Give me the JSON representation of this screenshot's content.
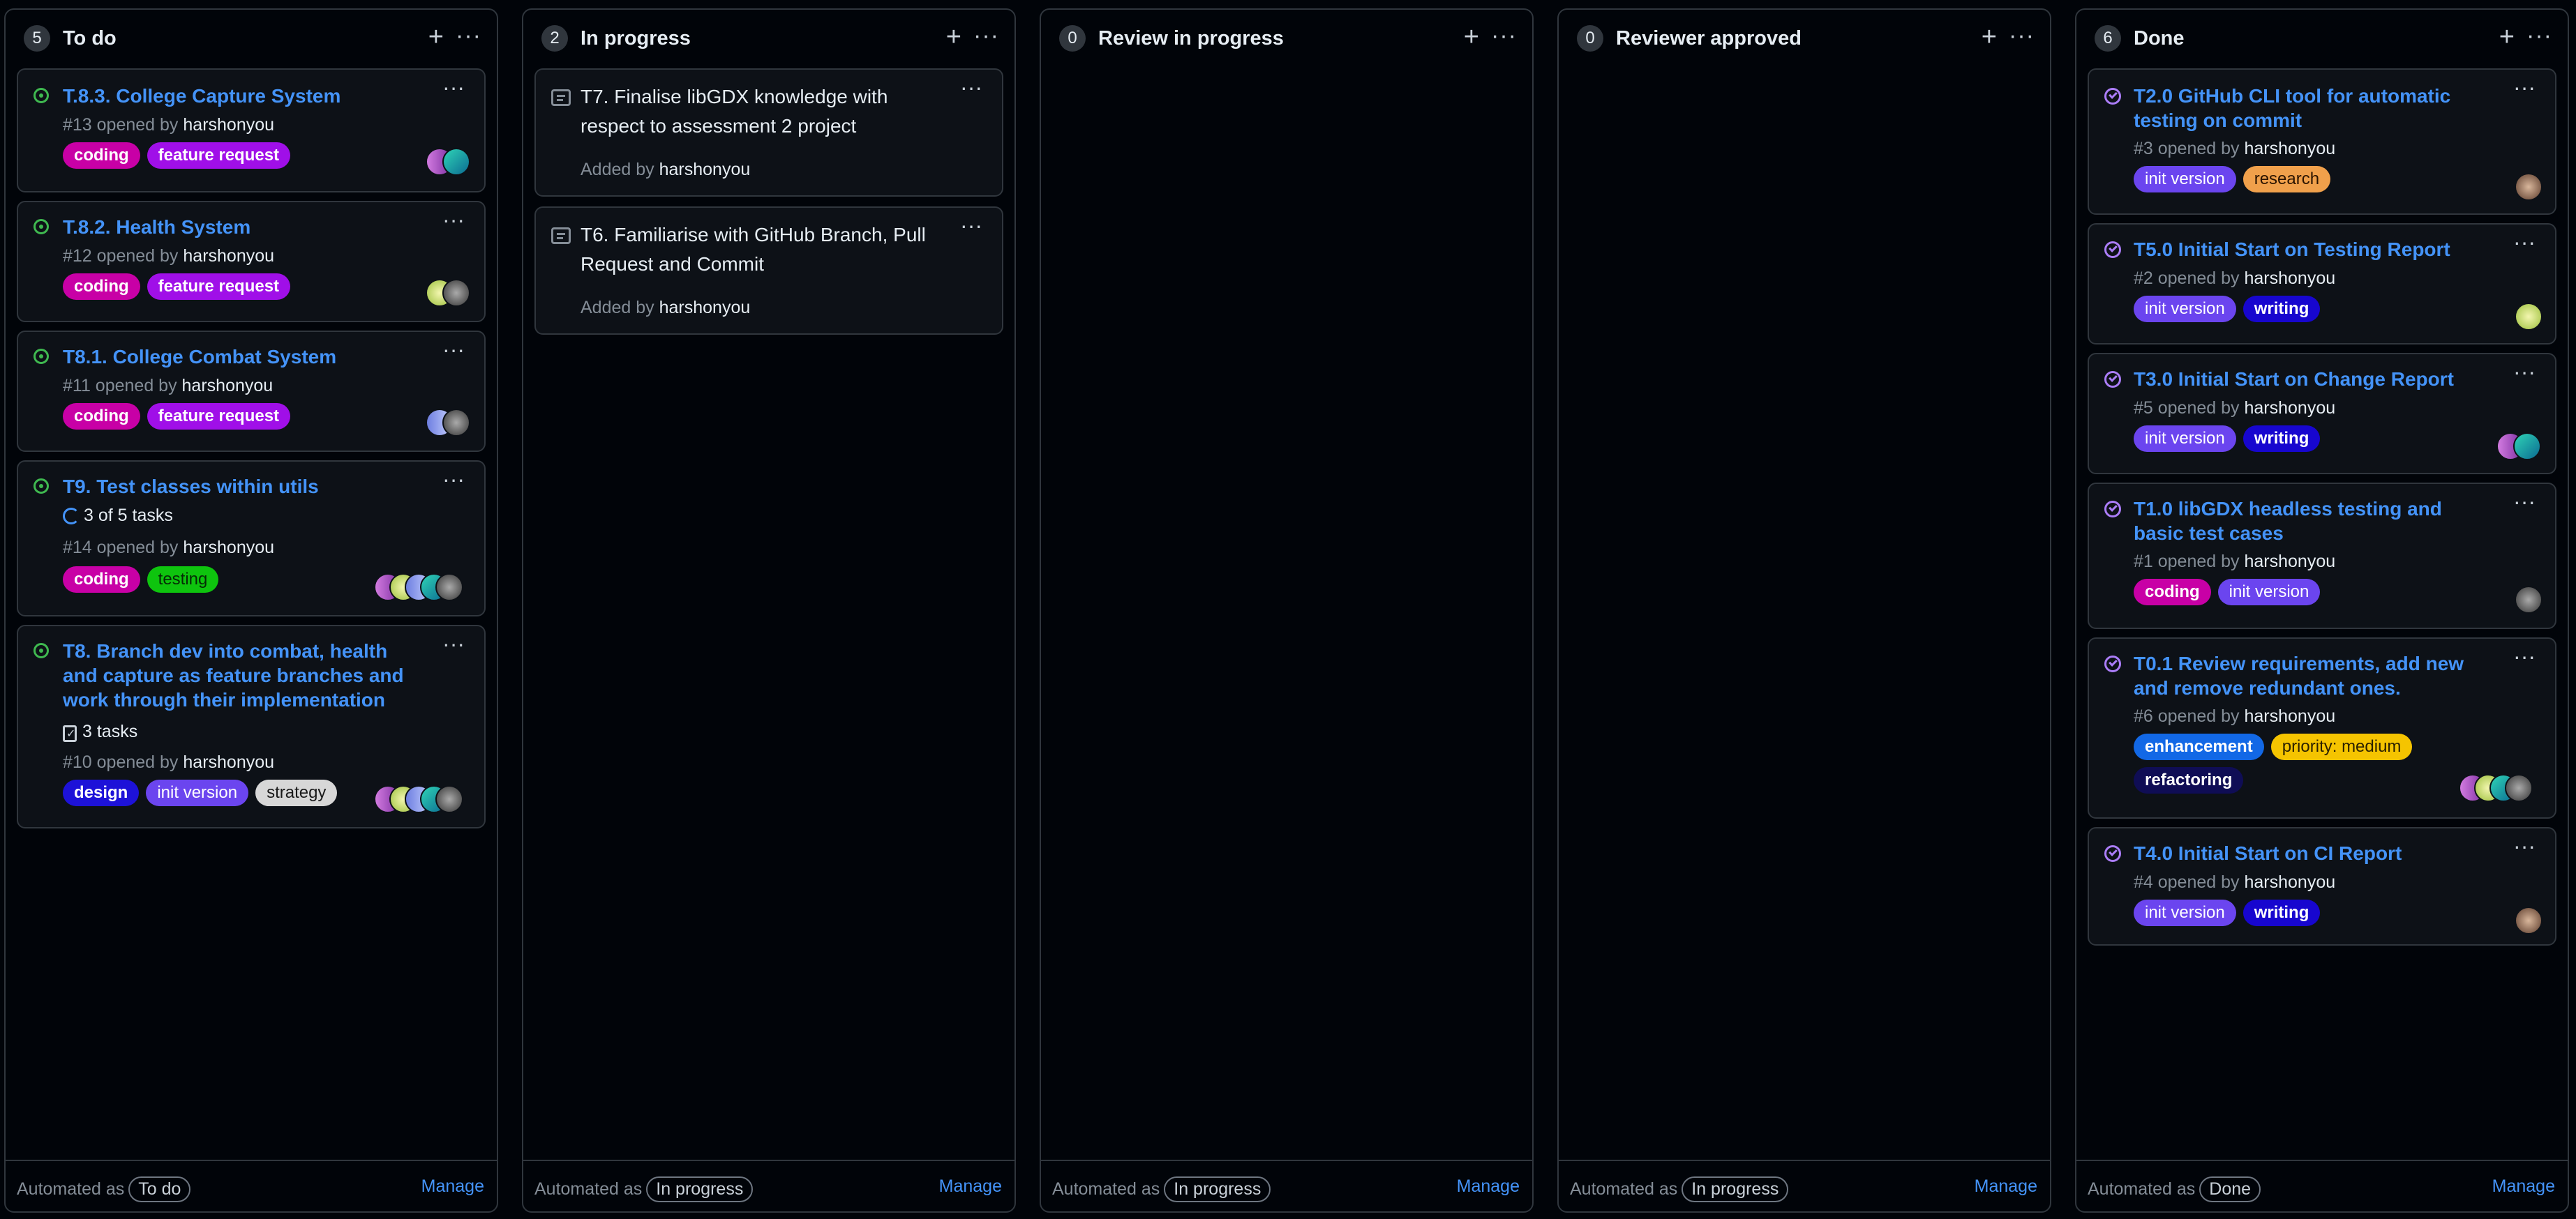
{
  "columns": [
    {
      "count": "5",
      "title": "To do",
      "auto_label": "Automated as",
      "auto_value": "To do",
      "manage": "Manage",
      "cards": [
        {
          "title": "T.8.3. College Capture System",
          "meta_prefix": "#13 opened by",
          "user": "harshonyou",
          "labels": [
            "coding",
            "feature request"
          ]
        },
        {
          "title": "T.8.2. Health System",
          "meta_prefix": "#12 opened by",
          "user": "harshonyou",
          "labels": [
            "coding",
            "feature request"
          ]
        },
        {
          "title": "T8.1. College Combat System",
          "meta_prefix": "#11 opened by",
          "user": "harshonyou",
          "labels": [
            "coding",
            "feature request"
          ]
        },
        {
          "title": "T9. Test classes within utils",
          "tasks": "3 of 5 tasks",
          "meta_prefix": "#14 opened by",
          "user": "harshonyou",
          "labels": [
            "coding",
            "testing"
          ],
          "task_progress": 0.6
        },
        {
          "title": "T8. Branch dev into combat, health and capture as feature branches and work through their implementation",
          "tasks": "3 tasks",
          "meta_prefix": "#10 opened by",
          "user": "harshonyou",
          "labels": [
            "design",
            "init version",
            "strategy"
          ]
        }
      ]
    },
    {
      "count": "2",
      "title": "In progress",
      "auto_label": "Automated as",
      "auto_value": "In progress",
      "manage": "Manage",
      "cards": [
        {
          "title": "T7. Finalise libGDX knowledge with respect to assessment 2 project",
          "meta_prefix": "Added by",
          "user": "harshonyou"
        },
        {
          "title": "T6. Familiarise with GitHub Branch, Pull Request and Commit",
          "meta_prefix": "Added by",
          "user": "harshonyou"
        }
      ]
    },
    {
      "count": "0",
      "title": "Review in progress",
      "auto_label": "Automated as",
      "auto_value": "In progress",
      "manage": "Manage",
      "cards": []
    },
    {
      "count": "0",
      "title": "Reviewer approved",
      "auto_label": "Automated as",
      "auto_value": "In progress",
      "manage": "Manage",
      "cards": []
    },
    {
      "count": "6",
      "title": "Done",
      "auto_label": "Automated as",
      "auto_value": "Done",
      "manage": "Manage",
      "cards": [
        {
          "title": "T2.0 GitHub CLI tool for automatic testing on commit",
          "meta_prefix": "#3 opened by",
          "user": "harshonyou",
          "labels": [
            "init version",
            "research"
          ]
        },
        {
          "title": "T5.0 Initial Start on Testing Report",
          "meta_prefix": "#2 opened by",
          "user": "harshonyou",
          "labels": [
            "init version",
            "writing"
          ]
        },
        {
          "title": "T3.0 Initial Start on Change Report",
          "meta_prefix": "#5 opened by",
          "user": "harshonyou",
          "labels": [
            "init version",
            "writing"
          ]
        },
        {
          "title": "T1.0 libGDX headless testing and basic test cases",
          "meta_prefix": "#1 opened by",
          "user": "harshonyou",
          "labels": [
            "coding",
            "init version"
          ]
        },
        {
          "title": "T0.1 Review requirements, add new and remove redundant ones.",
          "meta_prefix": "#6 opened by",
          "user": "harshonyou",
          "labels": [
            "enhancement",
            "priority: medium",
            "refactoring"
          ]
        },
        {
          "title": "T4.0 Initial Start on CI Report",
          "meta_prefix": "#4 opened by",
          "user": "harshonyou",
          "labels": [
            "init version",
            "writing"
          ]
        }
      ]
    }
  ],
  "label_colors": {
    "coding": {
      "bg": "#c800a6",
      "fg": "#ffffff"
    },
    "feature request": {
      "bg": "#a00fe8",
      "fg": "#ffffff"
    },
    "testing": {
      "bg": "#0ec40e",
      "fg": "#062a06"
    },
    "design": {
      "bg": "#1d12d8",
      "fg": "#ffffff"
    },
    "init version": {
      "bg": "#6b45ef",
      "fg": "#ffffff"
    },
    "strategy": {
      "bg": "#d7d7d7",
      "fg": "#1a1a1a"
    },
    "research": {
      "bg": "#f0a04b",
      "fg": "#2b1400"
    },
    "writing": {
      "bg": "#1706cf",
      "fg": "#ffffff"
    },
    "enhancement": {
      "bg": "#1268e6",
      "fg": "#ffffff"
    },
    "priority: medium": {
      "bg": "#f5c400",
      "fg": "#2b2100"
    },
    "refactoring": {
      "bg": "#0f0d55",
      "fg": "#ffffff"
    }
  }
}
